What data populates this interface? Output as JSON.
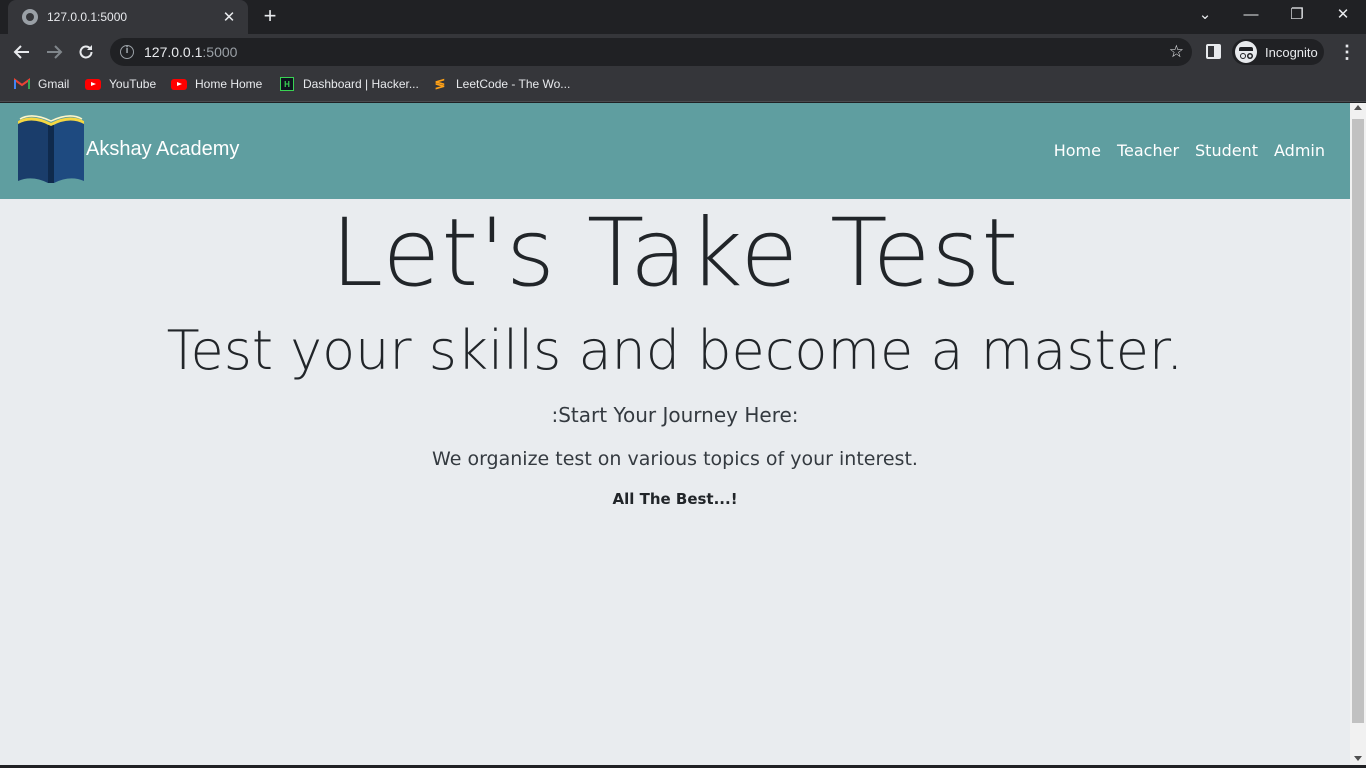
{
  "browser": {
    "tab_title": "127.0.0.1:5000",
    "tab_close": "✕",
    "new_tab": "+",
    "url_host": "127.0.0.1",
    "url_port": ":5000",
    "profile_label": "Incognito",
    "window_controls": {
      "dropdown": "⌄",
      "minimize": "—",
      "restore": "❐",
      "close": "✕"
    },
    "bookmarks": [
      {
        "label": "Gmail",
        "icon": "gmail-icon"
      },
      {
        "label": "YouTube",
        "icon": "youtube-icon"
      },
      {
        "label": "Home Home",
        "icon": "youtube-icon"
      },
      {
        "label": "Dashboard | Hacker...",
        "icon": "hackerrank-icon"
      },
      {
        "label": "LeetCode - The Wo...",
        "icon": "leetcode-icon"
      }
    ]
  },
  "site": {
    "brand": "Akshay Academy",
    "nav": [
      "Home",
      "Teacher",
      "Student",
      "Admin"
    ],
    "navbar_color": "#5f9ea0",
    "background_color": "#e9ecef"
  },
  "hero": {
    "title": "Let's Take Test",
    "subtitle": "Test your skills and become a master.",
    "line1": ":Start Your Journey Here:",
    "line2": "We organize test on various topics of your interest.",
    "line3": "All The Best...!"
  }
}
